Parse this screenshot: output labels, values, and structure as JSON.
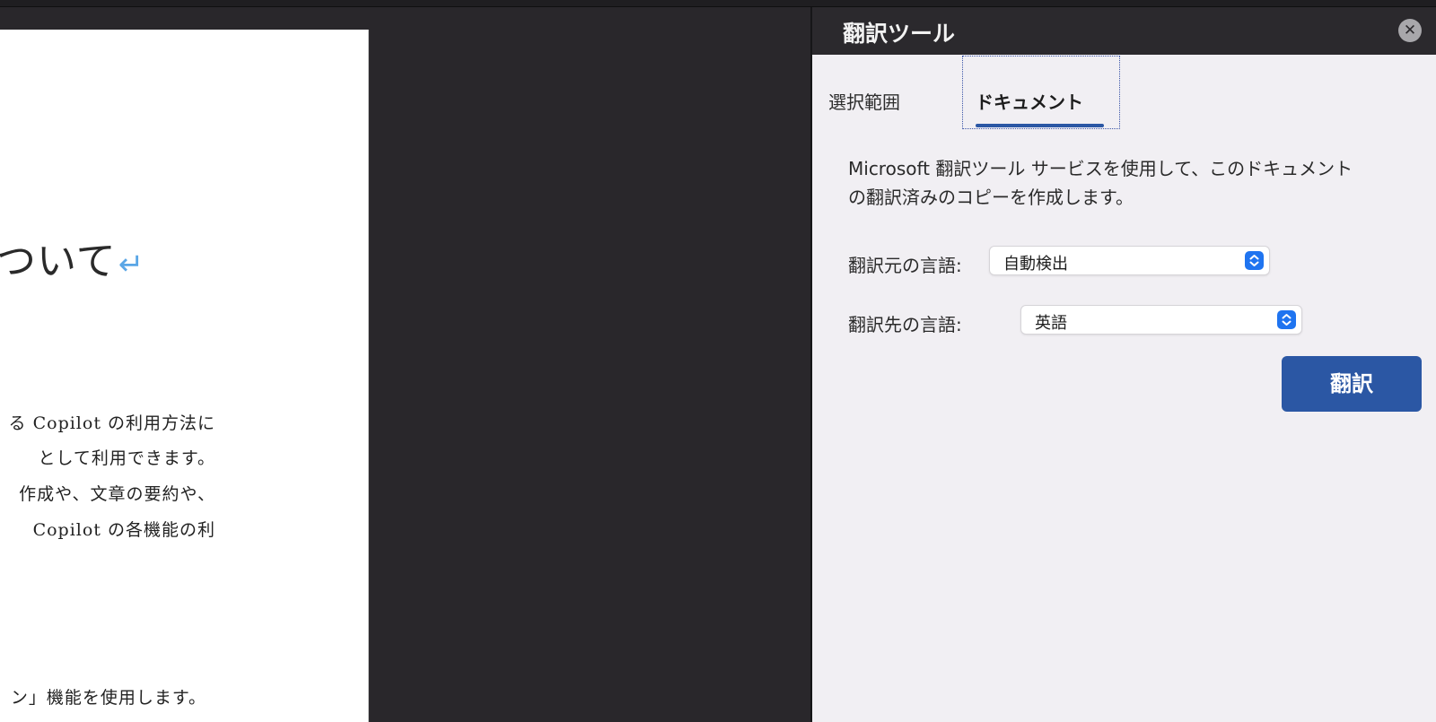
{
  "document": {
    "heading": "ついて",
    "return_mark": "↵",
    "lines": [
      "る Copilot の利用方法に",
      "として利用できます。",
      "作成や、文章の要約や、",
      "Copilot の各機能の利",
      "ン」機能を使用します。"
    ]
  },
  "pane": {
    "title": "翻訳ツール",
    "close_icon": "close-icon",
    "tabs": [
      {
        "label": "選択範囲",
        "selected": false
      },
      {
        "label": "ドキュメント",
        "selected": true
      }
    ],
    "description_line1": "Microsoft 翻訳ツール サービスを使用して、このドキュメント",
    "description_line2": "の翻訳済みのコピーを作成します。",
    "source_label": "翻訳元の言語:",
    "source_value": "自動検出",
    "target_label": "翻訳先の言語:",
    "target_value": "英語",
    "translate_button": "翻訳"
  },
  "colors": {
    "accent": "#2b57a4",
    "select_arrow": "#1f74f0",
    "pane_background": "#f1eff3",
    "header_background": "#2b292d",
    "workspace_background": "#29272b"
  }
}
